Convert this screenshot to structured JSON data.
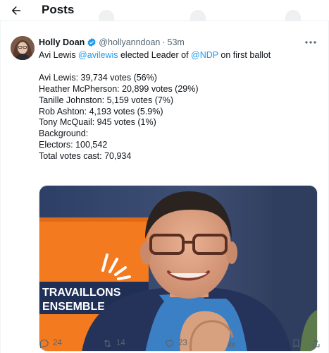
{
  "header": {
    "title": "Posts",
    "back_icon": "arrow-left-icon"
  },
  "tweet": {
    "author": {
      "name": "Holly Doan",
      "handle": "@hollyanndoan",
      "verified": true
    },
    "separator": "·",
    "time": "53m",
    "text": {
      "line1": {
        "prefix": "Avi Lewis ",
        "mention1": "@avilewis",
        "middle": " elected Leader of ",
        "mention2": "@NDP",
        "suffix": " on first ballot"
      },
      "results": [
        "Avi Lewis: 39,734 votes (56%)",
        "Heather McPherson: 20,899 votes (29%)",
        "Tanille Johnston: 5,159 votes (7%)",
        "Rob Ashton: 4,193 votes (5.9%)",
        "Tony McQuail: 945 votes (1%)",
        "Background:",
        "Electors: 100,542",
        "Total votes cast: 70,934"
      ]
    },
    "media": {
      "sign_text_1": "TRAVAILLONS",
      "sign_text_2": "ENSEMBLE"
    },
    "actions": {
      "replies": "24",
      "reposts": "14",
      "likes": "23"
    },
    "colors": {
      "link": "#1d9bf0",
      "muted": "#536471",
      "verified": "#1d9bf0"
    }
  }
}
